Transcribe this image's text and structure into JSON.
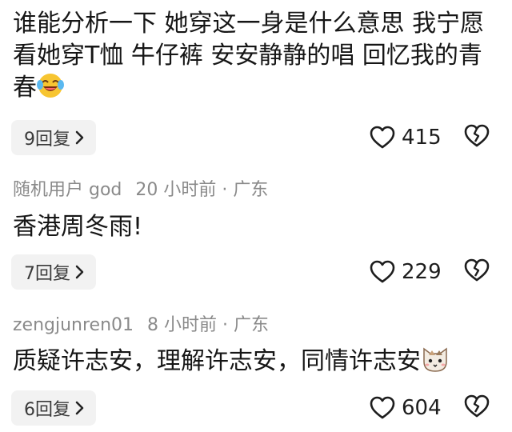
{
  "comments": [
    {
      "text": "谁能分析一下 她穿这一身是什么意思 我宁愿看她穿T恤 牛仔裤 安安静静的唱 回忆我的青春",
      "emoji": "laughing-crying-emoji",
      "reply_label": "9回复",
      "likes": "415"
    },
    {
      "user": "随机用户 god",
      "time": "20 小时前",
      "separator": "·",
      "location": "广东",
      "text": "香港周冬雨!",
      "reply_label": "7回复",
      "likes": "229"
    },
    {
      "user": "zengjunren01",
      "time": "8 小时前",
      "separator": "·",
      "location": "广东",
      "text": "质疑许志安，理解许志安，同情许志安",
      "emoji": "cat-face-emoji",
      "reply_label": "6回复",
      "likes": "604"
    }
  ]
}
